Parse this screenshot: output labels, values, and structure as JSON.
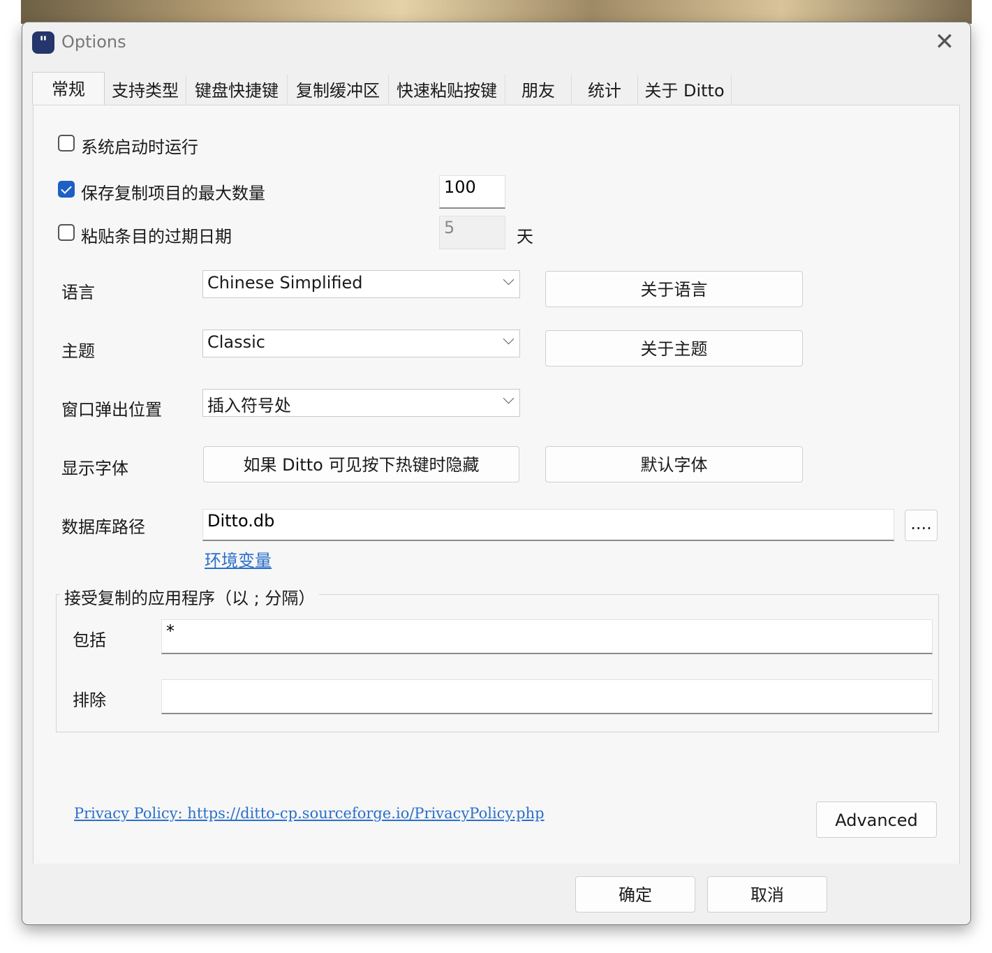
{
  "window": {
    "title": "Options",
    "app_icon_glyph": "\"",
    "close_glyph": "✕"
  },
  "tabs": [
    {
      "label": "常规",
      "active": true
    },
    {
      "label": "支持类型"
    },
    {
      "label": "键盘快捷键"
    },
    {
      "label": "复制缓冲区"
    },
    {
      "label": "快速粘贴按键"
    },
    {
      "label": "朋友"
    },
    {
      "label": "统计"
    },
    {
      "label": "关于 Ditto"
    }
  ],
  "general": {
    "start_on_boot": {
      "label": "系统启动时运行",
      "checked": false
    },
    "max_items": {
      "label": "保存复制项目的最大数量",
      "checked": true,
      "value": "100"
    },
    "expire": {
      "label": "粘贴条目的过期日期",
      "checked": false,
      "value": "5",
      "unit": "天"
    },
    "language": {
      "label": "语言",
      "value": "Chinese Simplified",
      "button": "关于语言"
    },
    "theme": {
      "label": "主题",
      "value": "Classic",
      "button": "关于主题"
    },
    "popup_position": {
      "label": "窗口弹出位置",
      "value": "插入符号处"
    },
    "font": {
      "label": "显示字体",
      "button": "如果 Ditto 可见按下热键时隐藏",
      "default_button": "默认字体"
    },
    "db_path": {
      "label": "数据库路径",
      "value": "Ditto.db",
      "browse": "....",
      "env_link": "环境变量"
    }
  },
  "accept_apps": {
    "title": "接受复制的应用程序（以 ; 分隔）",
    "include_label": "包括",
    "include_value": "*",
    "exclude_label": "排除",
    "exclude_value": ""
  },
  "footer": {
    "privacy_link": "Privacy Policy: https://ditto-cp.sourceforge.io/PrivacyPolicy.php",
    "advanced": "Advanced",
    "ok": "确定",
    "cancel": "取消"
  },
  "colors": {
    "accent": "#1e5fc4",
    "link": "#2a6fc9",
    "app_icon_bg": "#26356b"
  }
}
